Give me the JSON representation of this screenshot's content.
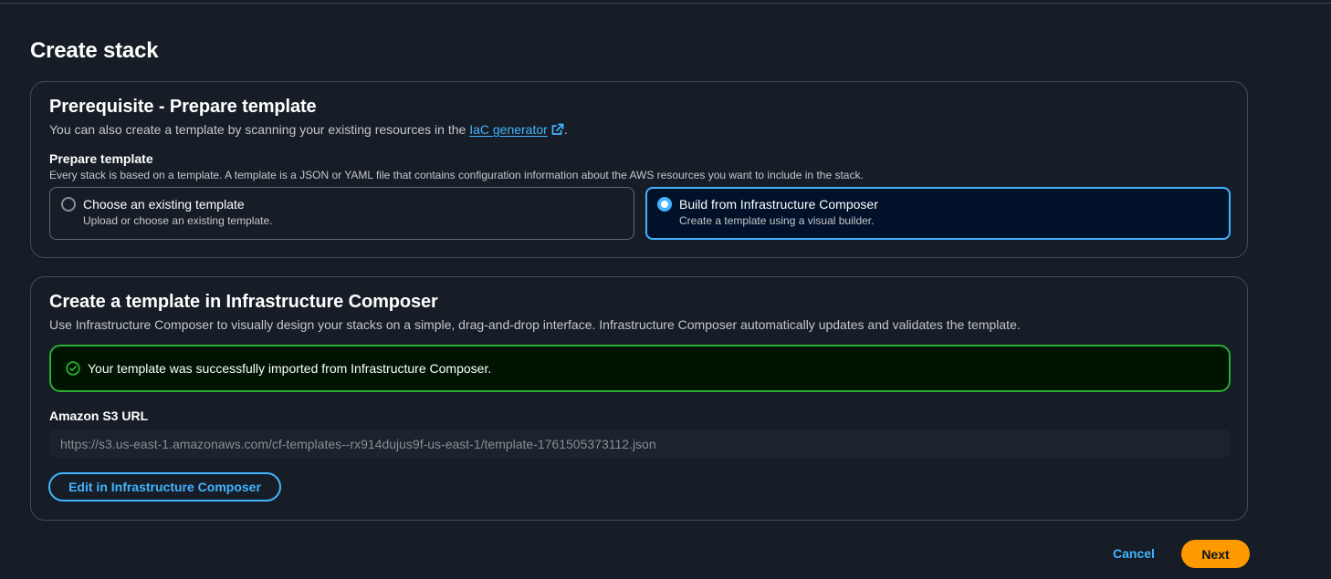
{
  "page": {
    "title": "Create stack"
  },
  "prerequisite": {
    "title": "Prerequisite - Prepare template",
    "description_prefix": "You can also create a template by scanning your existing resources in the ",
    "link_label": "IaC generator",
    "description_suffix": ".",
    "field_label": "Prepare template",
    "field_description": "Every stack is based on a template. A template is a JSON or YAML file that contains configuration information about the AWS resources you want to include in the stack.",
    "options": [
      {
        "label": "Choose an existing template",
        "sublabel": "Upload or choose an existing template.",
        "selected": false
      },
      {
        "label": "Build from Infrastructure Composer",
        "sublabel": "Create a template using a visual builder.",
        "selected": true
      }
    ]
  },
  "composer": {
    "title": "Create a template in Infrastructure Composer",
    "description": "Use Infrastructure Composer to visually design your stacks on a simple, drag-and-drop interface. Infrastructure Composer automatically updates and validates the template.",
    "alert_text": "Your template was successfully imported from Infrastructure Composer.",
    "s3_label": "Amazon S3 URL",
    "s3_url": "https://s3.us-east-1.amazonaws.com/cf-templates--rx914dujus9f-us-east-1/template-1761505373112.json",
    "edit_button": "Edit in Infrastructure Composer"
  },
  "footer": {
    "cancel_label": "Cancel",
    "next_label": "Next"
  },
  "icons": {
    "external_link": "external-link-icon",
    "success": "check-circle-icon"
  },
  "colors": {
    "accent_blue": "#42b4ff",
    "success_green": "#29ad32",
    "primary_orange": "#ff9900",
    "background": "#161d26"
  }
}
